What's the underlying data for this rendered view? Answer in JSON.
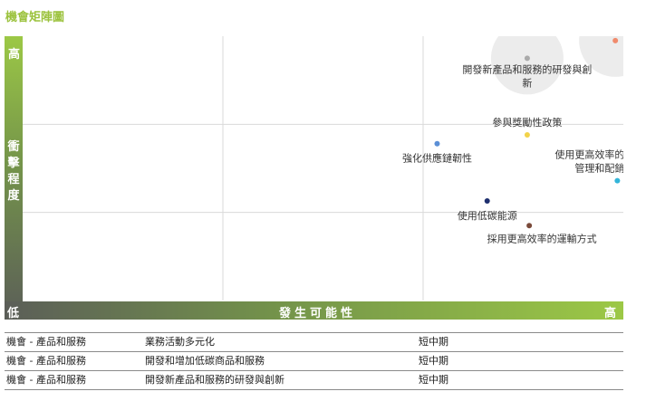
{
  "title": "機會矩陣圖",
  "y_axis": {
    "label": "衝擊程度",
    "high_label": "高"
  },
  "x_axis": {
    "label": "發生可能性",
    "low_label": "低",
    "high_label": "高"
  },
  "chart_data": {
    "type": "scatter",
    "title": "機會矩陣圖",
    "xlabel": "發生可能性",
    "ylabel": "衝擊程度",
    "xlim": [
      0,
      3
    ],
    "ylim": [
      0,
      3
    ],
    "grid": true,
    "points": [
      {
        "label": "開發和增加低碳商品和服務",
        "x": 2.96,
        "y": 2.95,
        "color": "#f08a6c",
        "bubble": true
      },
      {
        "label": "開發新產品和服務的研發與創新",
        "x": 2.52,
        "y": 2.75,
        "color": "#aaaaaa",
        "bubble": true
      },
      {
        "label": "參與獎勵性政策",
        "x": 2.52,
        "y": 1.88,
        "color": "#f2d34a",
        "bubble": false
      },
      {
        "label": "強化供應鏈韌性",
        "x": 2.07,
        "y": 1.78,
        "color": "#5b8fd6",
        "bubble": false
      },
      {
        "label": "使用更高效率的生產管理和配銷流程",
        "x": 2.97,
        "y": 1.36,
        "color": "#33b5d9",
        "bubble": false
      },
      {
        "label": "使用低碳能源",
        "x": 2.32,
        "y": 1.13,
        "color": "#1e2f6e",
        "bubble": false
      },
      {
        "label": "採用更高效率的運輸方式",
        "x": 2.53,
        "y": 0.85,
        "color": "#7a4a3a",
        "bubble": false
      }
    ]
  },
  "table": {
    "rows": [
      {
        "category": "機會 - 產品和服務",
        "item": "業務活動多元化",
        "term": "短中期"
      },
      {
        "category": "機會 - 產品和服務",
        "item": "開發和增加低碳商品和服務",
        "term": "短中期"
      },
      {
        "category": "機會 - 產品和服務",
        "item": "開發新產品和服務的研發與創新",
        "term": "短中期"
      }
    ]
  }
}
